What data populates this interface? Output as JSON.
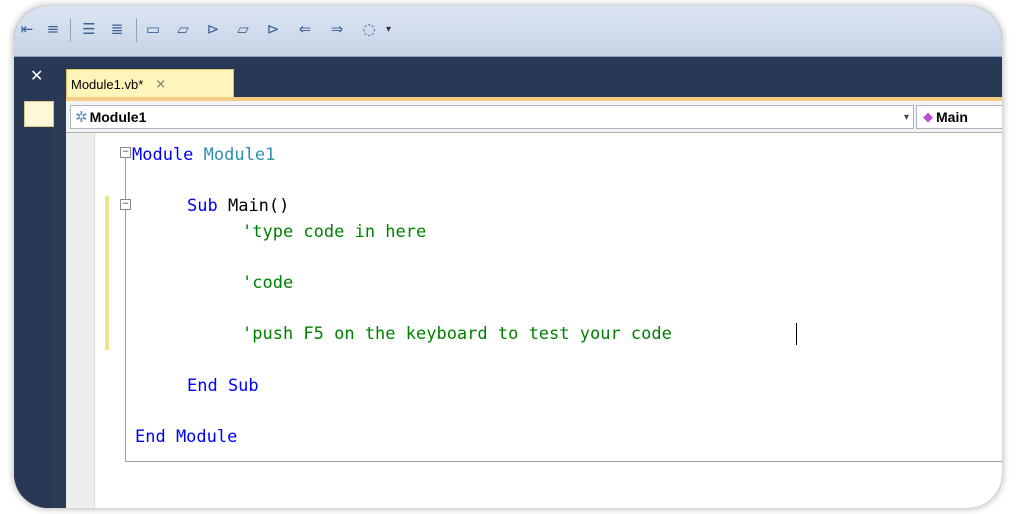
{
  "toolbar": {
    "icons": [
      "indent-icon",
      "align-icon",
      "comment-icon",
      "uncomment-icon",
      "frame-icon",
      "bubble-icon",
      "bubble-arrow-icon",
      "bubble-prev-icon",
      "bubble-next-icon",
      "bookmark-prev-icon",
      "bookmark-next-icon",
      "bookmark-clear-icon"
    ]
  },
  "tab": {
    "label": "Module1.vb*",
    "close": "×"
  },
  "navbar": {
    "left_label": "Module1",
    "right_label": "Main"
  },
  "code": {
    "line1_kw": "Module",
    "line1_name": "Module1",
    "line3_kw": "Sub",
    "line3_name": "Main()",
    "line4": "'type code in here",
    "line6": "'code",
    "line8": "'push F5 on the keyboard to test your code",
    "line10": "End Sub",
    "line12": "End Module"
  },
  "colors": {
    "keyword": "#0000ff",
    "type": "#2b91af",
    "comment": "#008000",
    "tab_active": "#fff4ba",
    "dark_chrome": "#293955"
  }
}
